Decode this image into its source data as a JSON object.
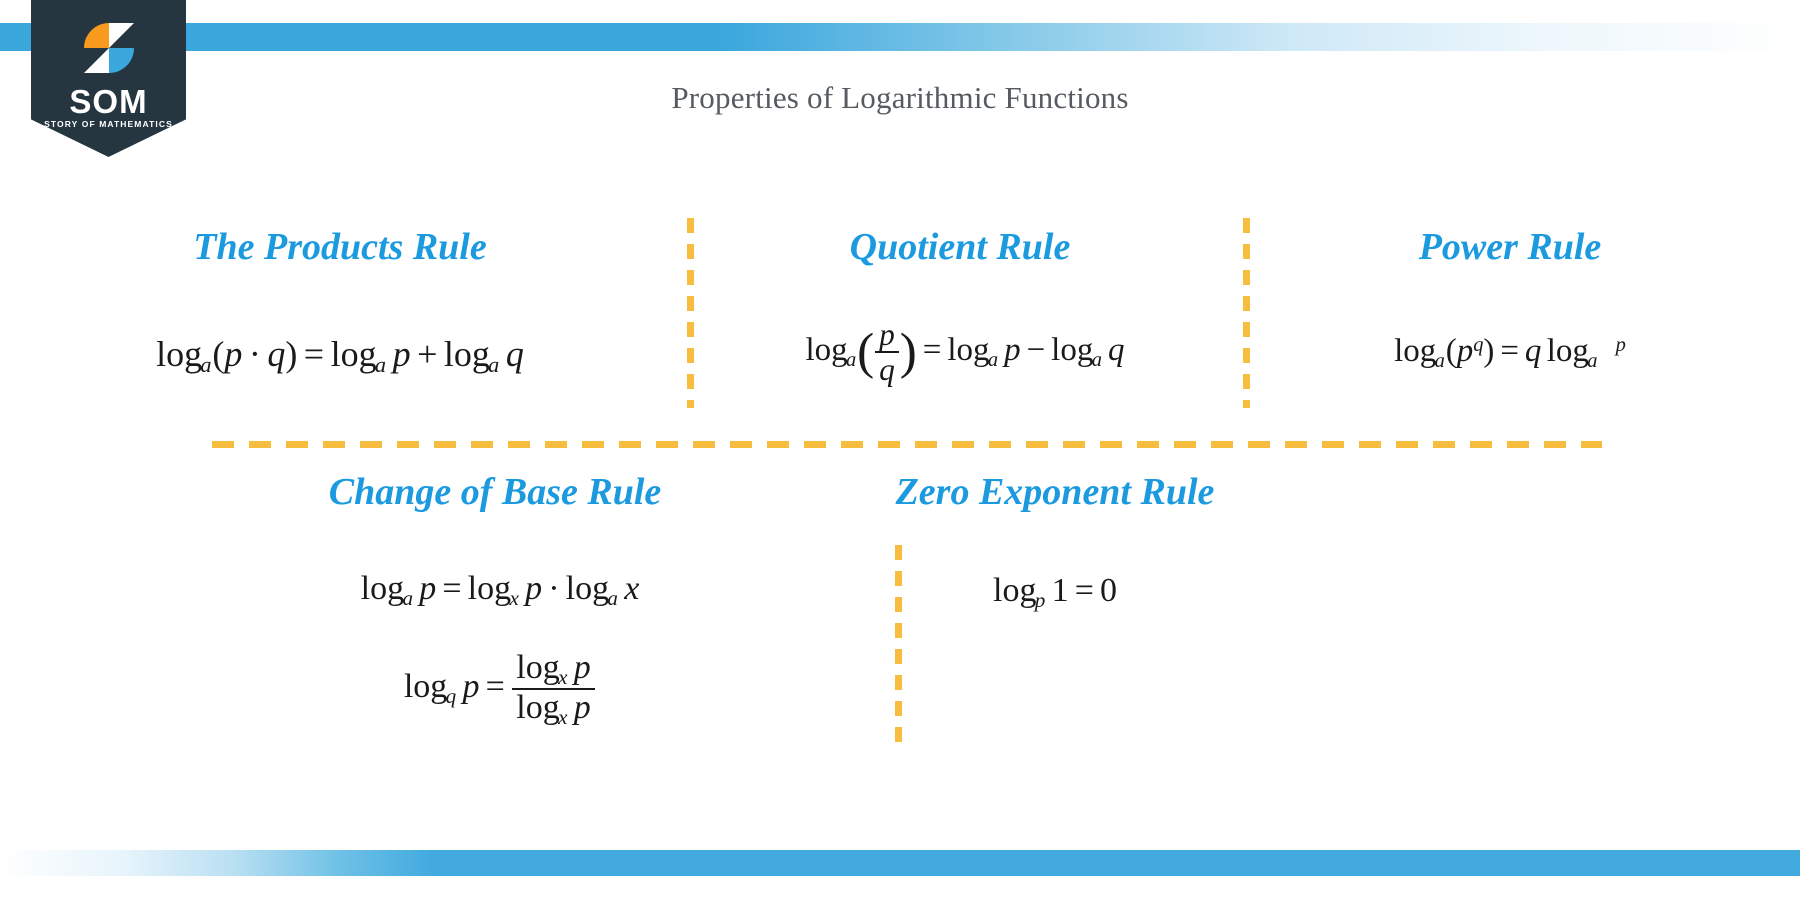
{
  "header": {
    "title": "Properties of Logarithmic Functions"
  },
  "logo": {
    "wordmark": "SOM",
    "tagline": "STORY OF MATHEMATICS",
    "badge_color": "#253640",
    "mark_orange": "#f79a1e",
    "mark_blue": "#3aa7dd",
    "mark_white": "#ffffff"
  },
  "colors": {
    "accent_blue": "#1b9ae0",
    "bar_blue": "#42aadf",
    "divider_yellow": "#f7bd3e",
    "title_gray": "#555b60",
    "formula_black": "#1a1a1a"
  },
  "rules": {
    "products": {
      "heading": "The Products Rule",
      "formula_text": "log_a(p · q) = log_a p + log_a q",
      "parts": {
        "log1": "log",
        "base1": "a",
        "open": "(",
        "p": "p",
        "dot": "·",
        "q": "q",
        "close": ")",
        "eq": "=",
        "log2": "log",
        "base2": "a",
        "p2": "p",
        "plus": "+",
        "log3": "log",
        "base3": "a",
        "q2": "q"
      }
    },
    "quotient": {
      "heading": "Quotient Rule",
      "formula_text": "log_a(p/q) = log_a p − log_a q",
      "parts": {
        "log1": "log",
        "base1": "a",
        "open": "(",
        "num": "p",
        "den": "q",
        "close": ")",
        "eq": "=",
        "log2": "log",
        "base2": "a",
        "p2": "p",
        "minus": "−",
        "log3": "log",
        "base3": "a",
        "q2": "q"
      }
    },
    "power": {
      "heading": "Power Rule",
      "formula_text": "log_a(p^q) = q log_a p",
      "parts": {
        "log1": "log",
        "base1": "a",
        "open": "(",
        "p": "p",
        "exp": "q",
        "close": ")",
        "eq": "=",
        "q": "q",
        "log2": "log",
        "base2": "a",
        "p2": "p"
      }
    },
    "change_of_base": {
      "heading": "Change of Base Rule",
      "formula1_text": "log_a p = log_x p · log_a x",
      "formula2_text": "log_q p = log_x p / log_x p",
      "parts1": {
        "log1": "log",
        "base1": "a",
        "p1": "p",
        "eq": "=",
        "log2": "log",
        "base2": "x",
        "p2": "p",
        "dot": "·",
        "log3": "log",
        "base3": "a",
        "x": "x"
      },
      "parts2": {
        "log1": "log",
        "base1": "q",
        "p1": "p",
        "eq": "=",
        "lognum": "log",
        "basenum": "x",
        "pnum": "p",
        "logden": "log",
        "baseden": "x",
        "pden": "p"
      }
    },
    "zero_exponent": {
      "heading": "Zero Exponent Rule",
      "formula_text": "log_p 1 = 0",
      "parts": {
        "log1": "log",
        "base1": "p",
        "one": "1",
        "eq": "=",
        "zero": "0"
      }
    }
  }
}
